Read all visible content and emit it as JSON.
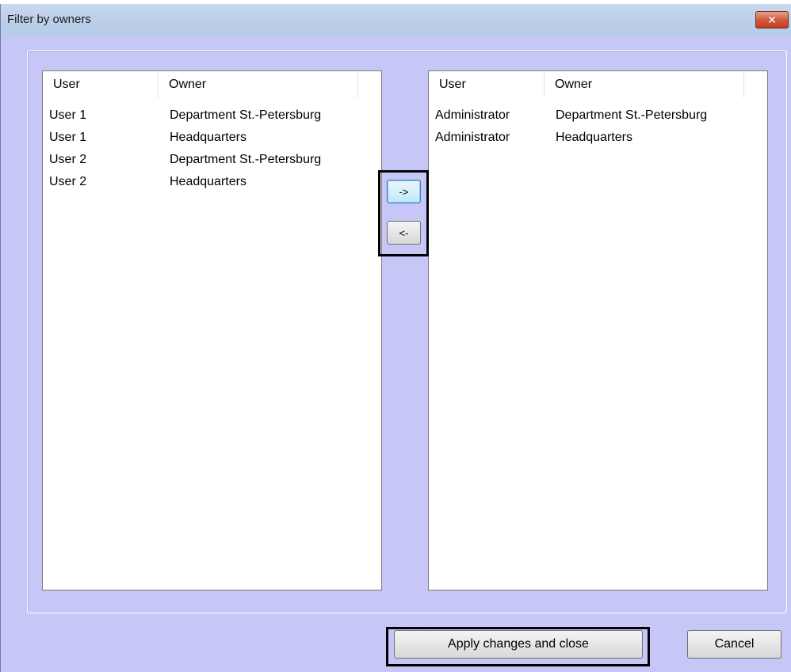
{
  "window": {
    "title": "Filter by owners",
    "close_label": "✕"
  },
  "left_list": {
    "columns": [
      "User",
      "Owner"
    ],
    "rows": [
      {
        "user": "User 1",
        "owner": "Department St.-Petersburg"
      },
      {
        "user": "User 1",
        "owner": "Headquarters"
      },
      {
        "user": "User 2",
        "owner": "Department St.-Petersburg"
      },
      {
        "user": "User 2",
        "owner": "Headquarters"
      }
    ]
  },
  "right_list": {
    "columns": [
      "User",
      "Owner"
    ],
    "rows": [
      {
        "user": "Administrator",
        "owner": "Department St.-Petersburg"
      },
      {
        "user": "Administrator",
        "owner": "Headquarters"
      }
    ]
  },
  "transfer": {
    "move_right_label": "->",
    "move_left_label": "<-"
  },
  "footer": {
    "apply_label": "Apply changes and close",
    "cancel_label": "Cancel"
  }
}
